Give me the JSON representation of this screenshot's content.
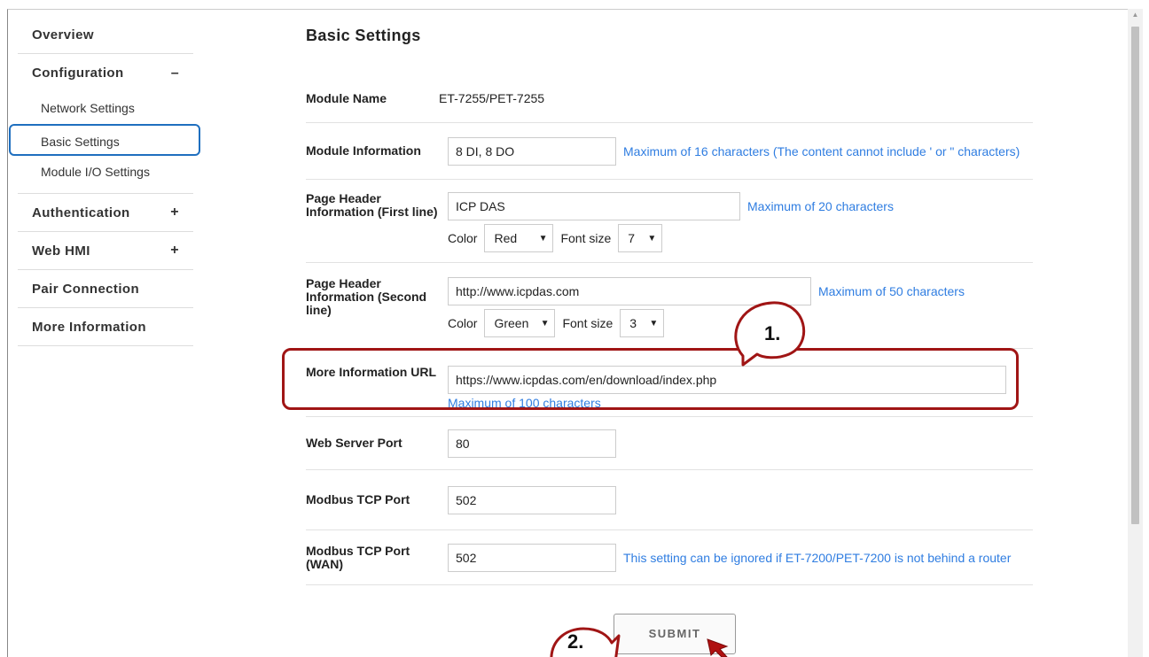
{
  "sidebar": {
    "overview": "Overview",
    "configuration": {
      "label": "Configuration",
      "toggle": "–"
    },
    "sub_items": [
      "Network Settings",
      "Basic Settings",
      "Module I/O Settings"
    ],
    "authentication": {
      "label": "Authentication",
      "toggle": "+"
    },
    "web_hmi": {
      "label": "Web HMI",
      "toggle": "+"
    },
    "pair_connection": "Pair Connection",
    "more_information": "More Information"
  },
  "main": {
    "title": "Basic Settings",
    "module_name": {
      "label": "Module Name",
      "value": "ET-7255/PET-7255"
    },
    "module_information": {
      "label": "Module Information",
      "value": "8 DI, 8 DO",
      "hint": "Maximum of 16 characters (The content cannot include ' or \" characters)"
    },
    "header_first": {
      "label": "Page Header Information (First line)",
      "value": "ICP DAS",
      "hint": "Maximum of 20 characters",
      "color_label": "Color",
      "color_value": "Red",
      "font_label": "Font size",
      "font_value": "7"
    },
    "header_second": {
      "label": "Page Header Information (Second line)",
      "value": "http://www.icpdas.com",
      "hint": "Maximum of 50 characters",
      "color_label": "Color",
      "color_value": "Green",
      "font_label": "Font size",
      "font_value": "3"
    },
    "more_info_url": {
      "label": "More Information URL",
      "value": "https://www.icpdas.com/en/download/index.php",
      "hint": "Maximum of 100 characters"
    },
    "web_server_port": {
      "label": "Web Server Port",
      "value": "80"
    },
    "modbus_tcp_port": {
      "label": "Modbus TCP Port",
      "value": "502"
    },
    "modbus_tcp_port_wan": {
      "label": "Modbus TCP Port (WAN)",
      "value": "502",
      "hint": "This setting can be ignored if ET-7200/PET-7200 is not behind a router"
    },
    "submit_label": "SUBMIT"
  },
  "annotations": {
    "step1": "1.",
    "step2": "2."
  },
  "colors": {
    "accent_blue": "#2f7de1",
    "annotation_red": "#a01515",
    "active_outline": "#1f6fbf"
  }
}
